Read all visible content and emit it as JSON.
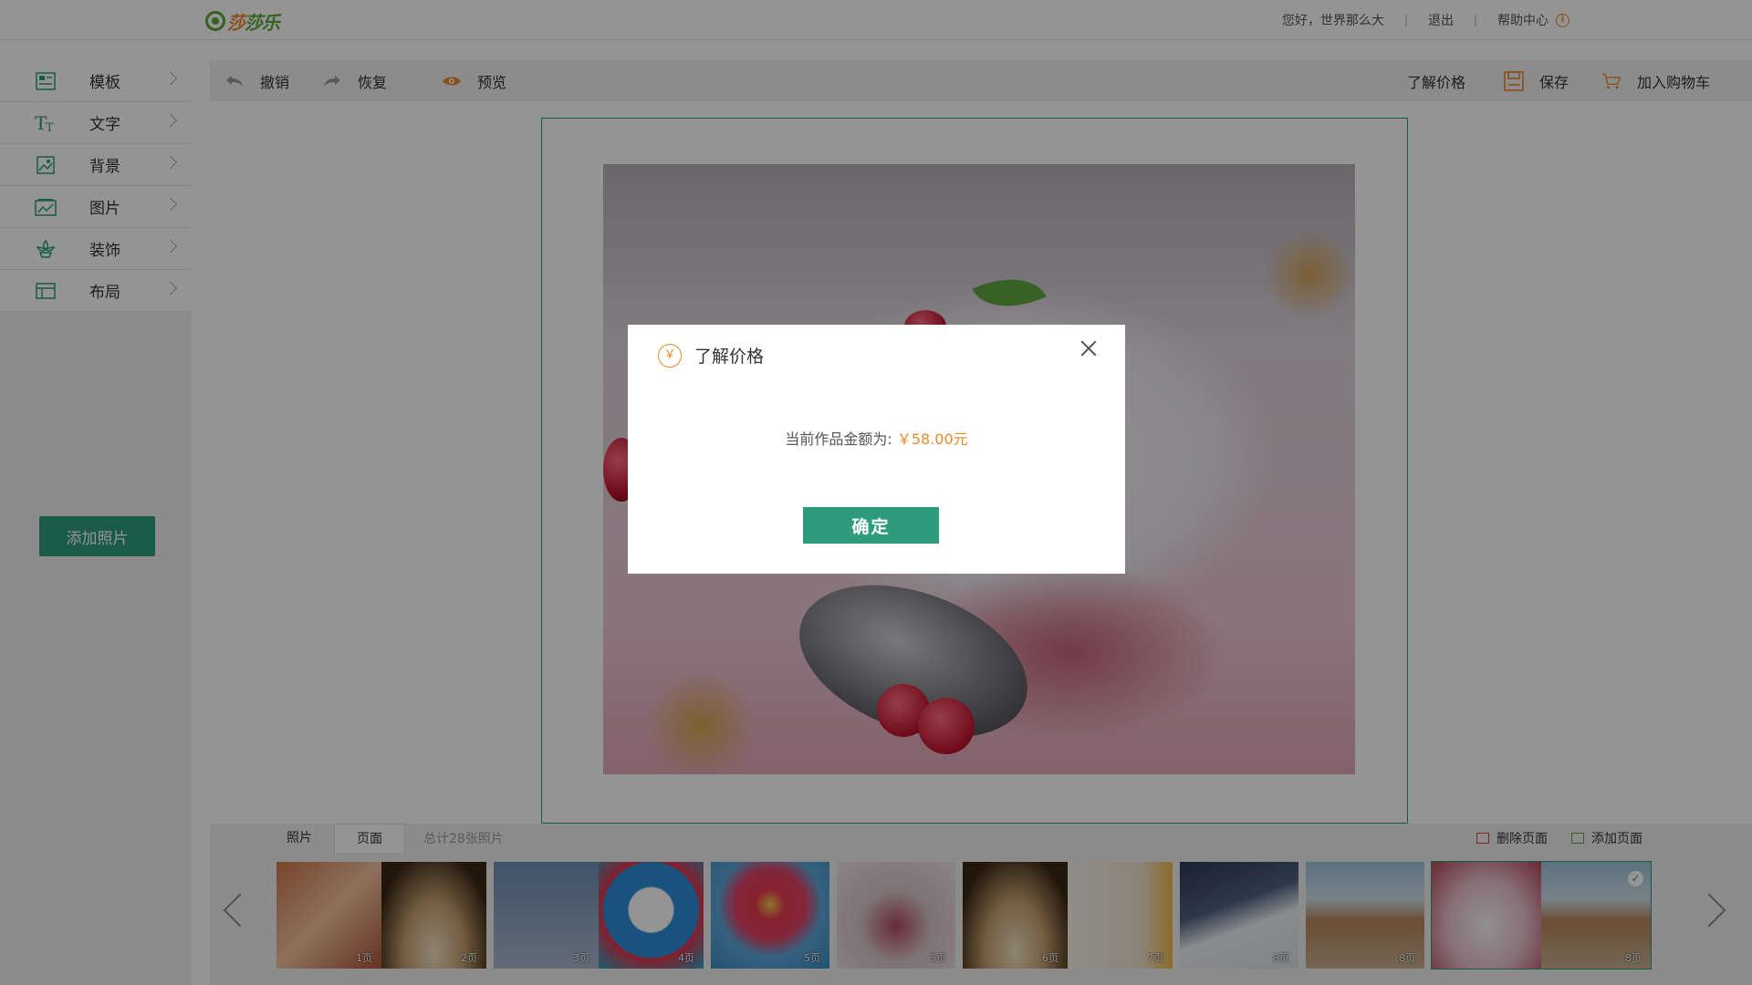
{
  "header": {
    "logo_text_a": "莎",
    "logo_text_b": "莎乐",
    "greeting": "您好，世界那么大",
    "separator": "|",
    "logout": "退出",
    "help": "帮助中心",
    "info_glyph": "i"
  },
  "sidebar": {
    "items": [
      {
        "label": "模板",
        "icon": "template-icon"
      },
      {
        "label": "文字",
        "icon": "text-icon"
      },
      {
        "label": "背景",
        "icon": "background-icon"
      },
      {
        "label": "图片",
        "icon": "image-icon"
      },
      {
        "label": "装饰",
        "icon": "decoration-icon"
      },
      {
        "label": "布局",
        "icon": "layout-icon"
      }
    ],
    "add_photo": "添加照片"
  },
  "toolbar": {
    "undo": "撤销",
    "redo": "恢复",
    "preview": "预览",
    "price_info": "了解价格",
    "save": "保存",
    "add_to_cart": "加入购物车"
  },
  "bottom": {
    "tab_photos": "照片",
    "tab_pages": "页面",
    "total": "总计28张照片",
    "delete_page": "删除页面",
    "add_page": "添加页面",
    "thumbnails": [
      {
        "labels": [
          "1页",
          "2页"
        ]
      },
      {
        "labels": [
          "3页",
          "4页"
        ]
      },
      {
        "labels": [
          "5页"
        ]
      },
      {
        "labels": [
          "5页"
        ]
      },
      {
        "labels": [
          "6页",
          "7页"
        ]
      },
      {
        "labels": [
          "8页"
        ]
      },
      {
        "labels": [
          "8页"
        ]
      },
      {
        "labels": [
          "",
          "8页"
        ]
      }
    ]
  },
  "modal": {
    "title": "了解价格",
    "yen_glyph": "￥",
    "amount_label": "当前作品金额为:",
    "amount_value": "￥58.00元",
    "confirm": "确定"
  },
  "colors": {
    "accent": "#2e9c7c",
    "orange": "#e98a2a"
  }
}
